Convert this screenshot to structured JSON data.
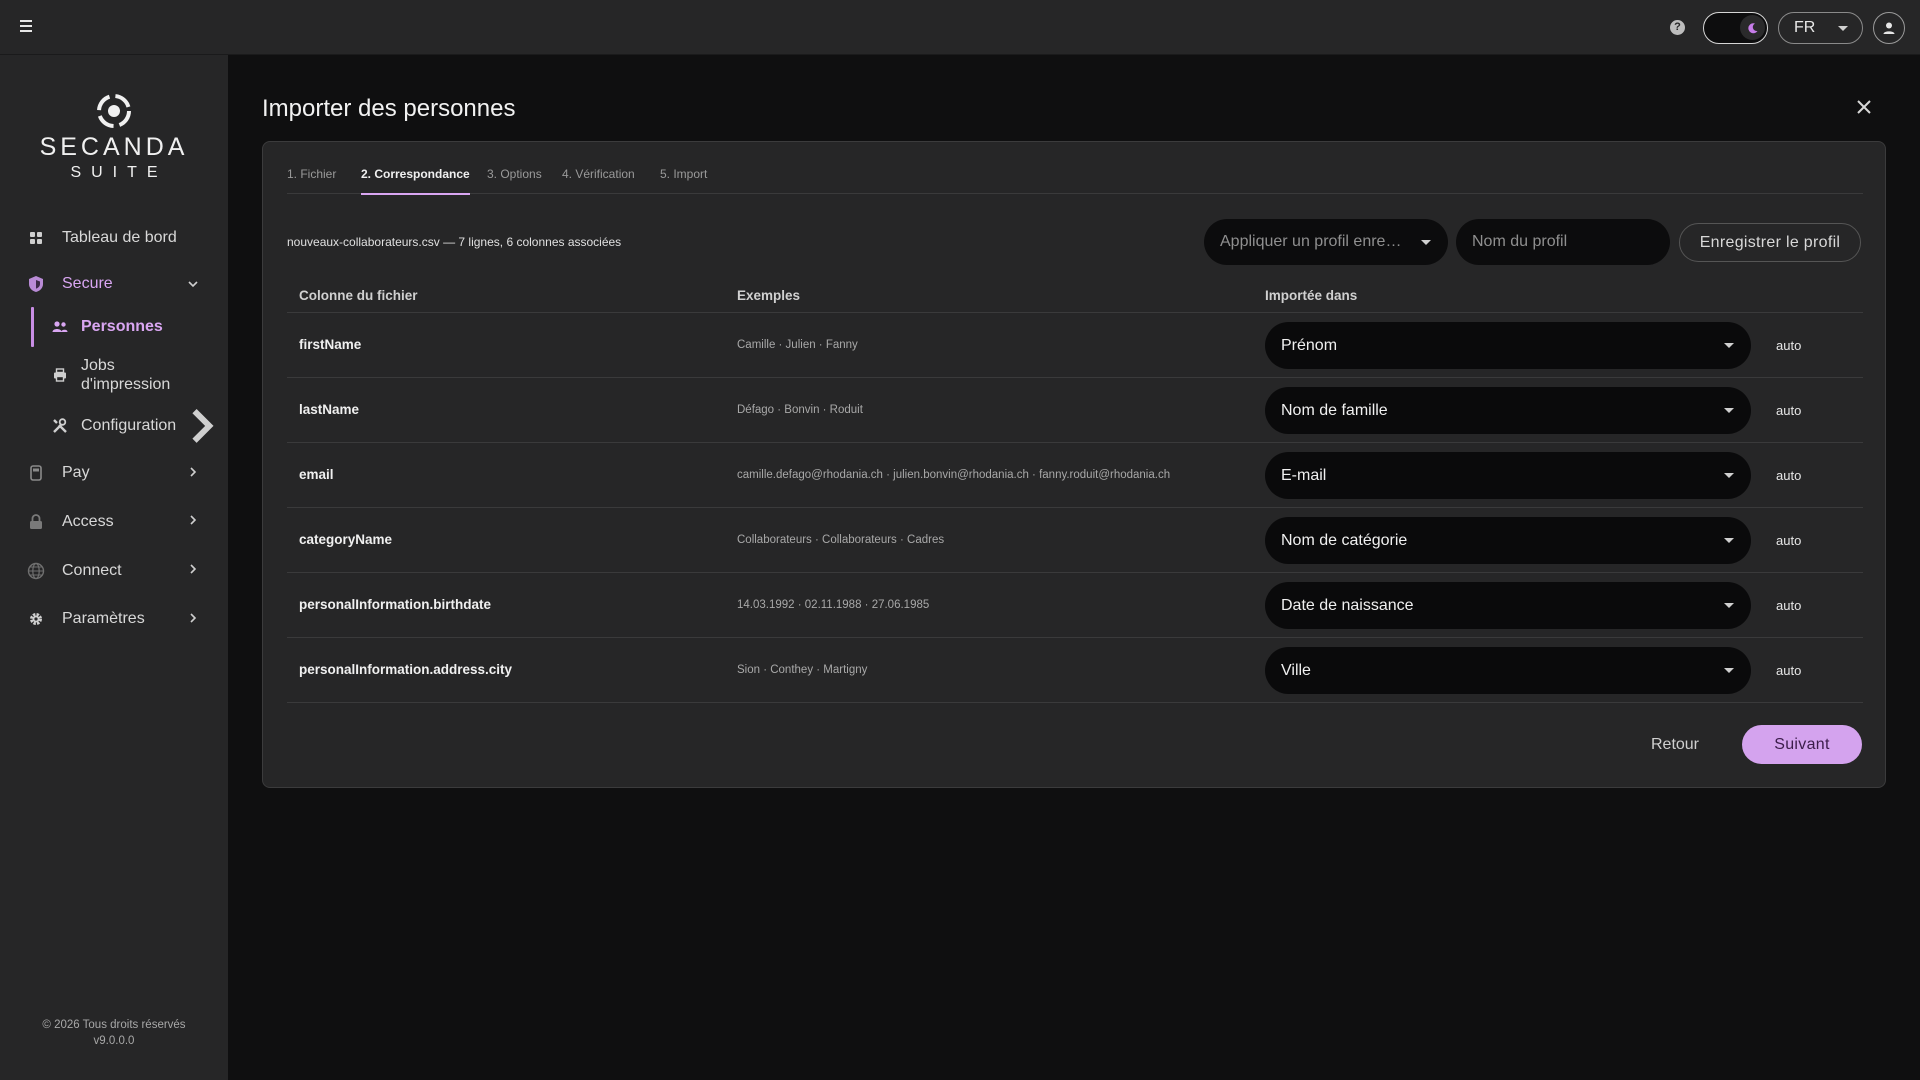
{
  "topbar": {
    "menu_icon": "hamburger-icon",
    "help_icon": "help-circle-icon",
    "help_glyph": "?",
    "theme_icon": "moon-icon",
    "language": "FR",
    "user_icon": "user-icon"
  },
  "sidebar": {
    "logo_line1": "SECANDA",
    "logo_line2": "SUITE",
    "items": [
      {
        "label": "Tableau de bord",
        "icon": "dashboard-icon"
      },
      {
        "label": "Secure",
        "icon": "shield-icon"
      },
      {
        "label": "Personnes",
        "icon": "people-icon"
      },
      {
        "label": "Jobs d'impression",
        "icon": "printer-icon"
      },
      {
        "label": "Configuration",
        "icon": "tools-icon"
      },
      {
        "label": "Pay",
        "icon": "payment-terminal-icon"
      },
      {
        "label": "Access",
        "icon": "lock-icon"
      },
      {
        "label": "Connect",
        "icon": "globe-icon"
      },
      {
        "label": "Paramètres",
        "icon": "gear-icon"
      }
    ],
    "copyright": "© 2026 Tous droits réservés",
    "version": "v9.0.0.0"
  },
  "main": {
    "title": "Importer des personnes",
    "tabs": [
      "1. Fichier",
      "2. Correspondance",
      "3. Options",
      "4. Vérification",
      "5. Import"
    ],
    "active_tab": "2. Correspondance",
    "file_info": "nouveaux-collaborateurs.csv — 7 lignes, 6 colonnes associées",
    "profile_select_placeholder": "Appliquer un profil enre…",
    "profile_name_placeholder": "Nom du profil",
    "save_profile_label": "Enregistrer le profil",
    "table": {
      "headers": [
        "Colonne du fichier",
        "Exemples",
        "Importée dans"
      ],
      "rows": [
        {
          "column": "firstName",
          "examples": "Camille · Julien · Fanny",
          "target": "Prénom",
          "mode": "auto"
        },
        {
          "column": "lastName",
          "examples": "Défago · Bonvin · Roduit",
          "target": "Nom de famille",
          "mode": "auto"
        },
        {
          "column": "email",
          "examples": "camille.defago@rhodania.ch · julien.bonvin@rhodania.ch · fanny.roduit@rhodania.ch",
          "target": "E-mail",
          "mode": "auto"
        },
        {
          "column": "categoryName",
          "examples": "Collaborateurs · Collaborateurs · Cadres",
          "target": "Nom de catégorie",
          "mode": "auto"
        },
        {
          "column": "personalInformation.birthdate",
          "examples": "14.03.1992 · 02.11.1988 · 27.06.1985",
          "target": "Date de naissance",
          "mode": "auto"
        },
        {
          "column": "personalInformation.address.city",
          "examples": "Sion · Conthey · Martigny",
          "target": "Ville",
          "mode": "auto"
        }
      ]
    },
    "back_label": "Retour",
    "next_label": "Suivant"
  },
  "colors": {
    "accent": "#d4a3ee",
    "accent_text": "#d9a6f2",
    "background": "#0f0f10",
    "surface": "#262627"
  }
}
